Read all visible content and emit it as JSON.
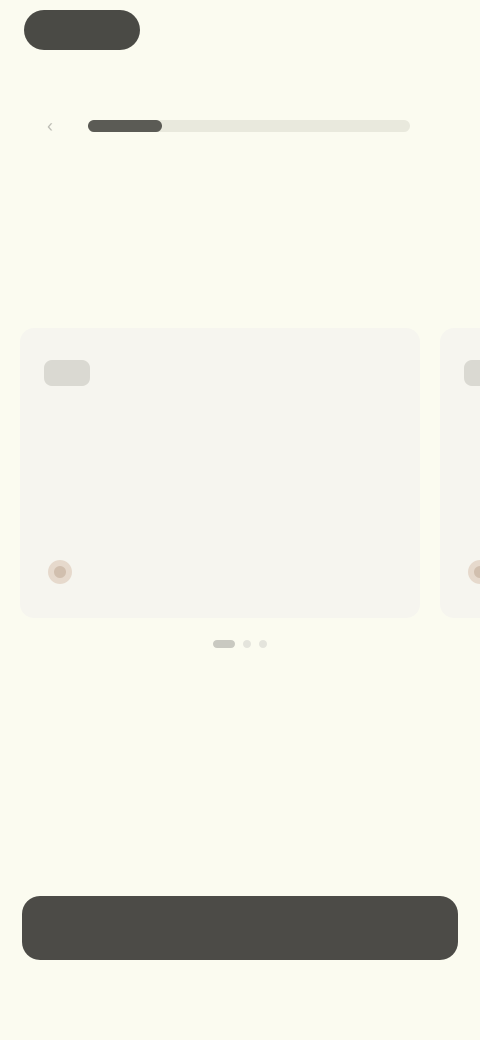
{
  "header": {
    "left_pill_label": "",
    "right_label": "",
    "caption": ""
  },
  "progress": {
    "value": 0.23
  },
  "heading": {
    "title_line_1": "",
    "title_line_2": "",
    "subtitle": ""
  },
  "carousel": {
    "active_index": 0,
    "cards": [
      {
        "badge": "",
        "tag": "",
        "text": "",
        "author": ""
      },
      {
        "badge": "",
        "tag": "",
        "text": "",
        "author": ""
      }
    ],
    "dot_count": 3
  },
  "cta": {
    "label": ""
  },
  "colors": {
    "background": "#fbfbf0",
    "dark": "#4c4b47",
    "accent": "#f0c48a",
    "card": "#f6f5ef"
  },
  "icons": {
    "back": "chevron-left-icon",
    "avatar": "user-avatar-icon"
  }
}
